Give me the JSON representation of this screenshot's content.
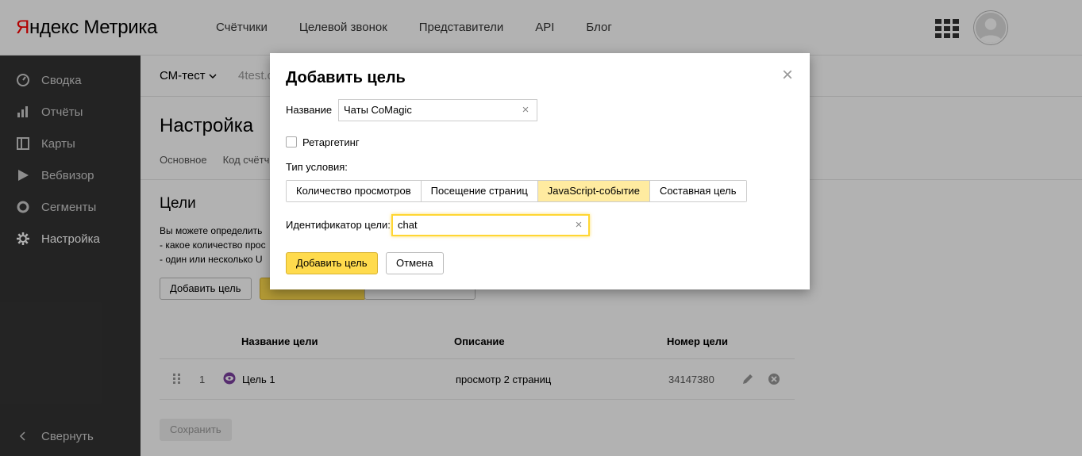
{
  "header": {
    "logo_ya": "Я",
    "logo_rest": "ндекс",
    "logo_product": "Метрика",
    "nav": [
      "Счётчики",
      "Целевой звонок",
      "Представители",
      "API",
      "Блог"
    ]
  },
  "sidebar": {
    "items": [
      {
        "label": "Сводка",
        "icon": "gauge-icon"
      },
      {
        "label": "Отчёты",
        "icon": "bar-chart-icon"
      },
      {
        "label": "Карты",
        "icon": "map-icon"
      },
      {
        "label": "Вебвизор",
        "icon": "play-icon"
      },
      {
        "label": "Сегменты",
        "icon": "pie-icon"
      },
      {
        "label": "Настройка",
        "icon": "gear-icon"
      }
    ],
    "collapse_label": "Свернуть"
  },
  "main": {
    "counter_name": "СМ-тест",
    "counter_url": "4test.c",
    "page_title": "Настройка",
    "subtabs": [
      "Основное",
      "Код счётч"
    ],
    "section_title": "Цели",
    "description_lines": [
      "Вы можете определить",
      "- какое количество прос",
      "- один или несколько U"
    ],
    "add_goal_button": "Добавить цель",
    "save_button": "Сохранить",
    "table": {
      "headers": {
        "name": "Название цели",
        "description": "Описание",
        "number": "Номер цели"
      },
      "rows": [
        {
          "index": "1",
          "name": "Цель 1",
          "description": "просмотр 2 страниц",
          "number": "34147380"
        }
      ]
    }
  },
  "dialog": {
    "title": "Добавить цель",
    "close_glyph": "×",
    "name_label": "Название",
    "name_value": "Чаты CoMagic",
    "retargeting_label": "Ретаргетинг",
    "condition_type_label": "Тип условия:",
    "condition_types": [
      "Количество просмотров",
      "Посещение страниц",
      "JavaScript-событие",
      "Составная цель"
    ],
    "active_condition": "JavaScript-событие",
    "goal_id_label": "Идентификатор цели:",
    "goal_id_value": "chat",
    "clear_glyph": "×",
    "submit_label": "Добавить цель",
    "cancel_label": "Отмена"
  }
}
